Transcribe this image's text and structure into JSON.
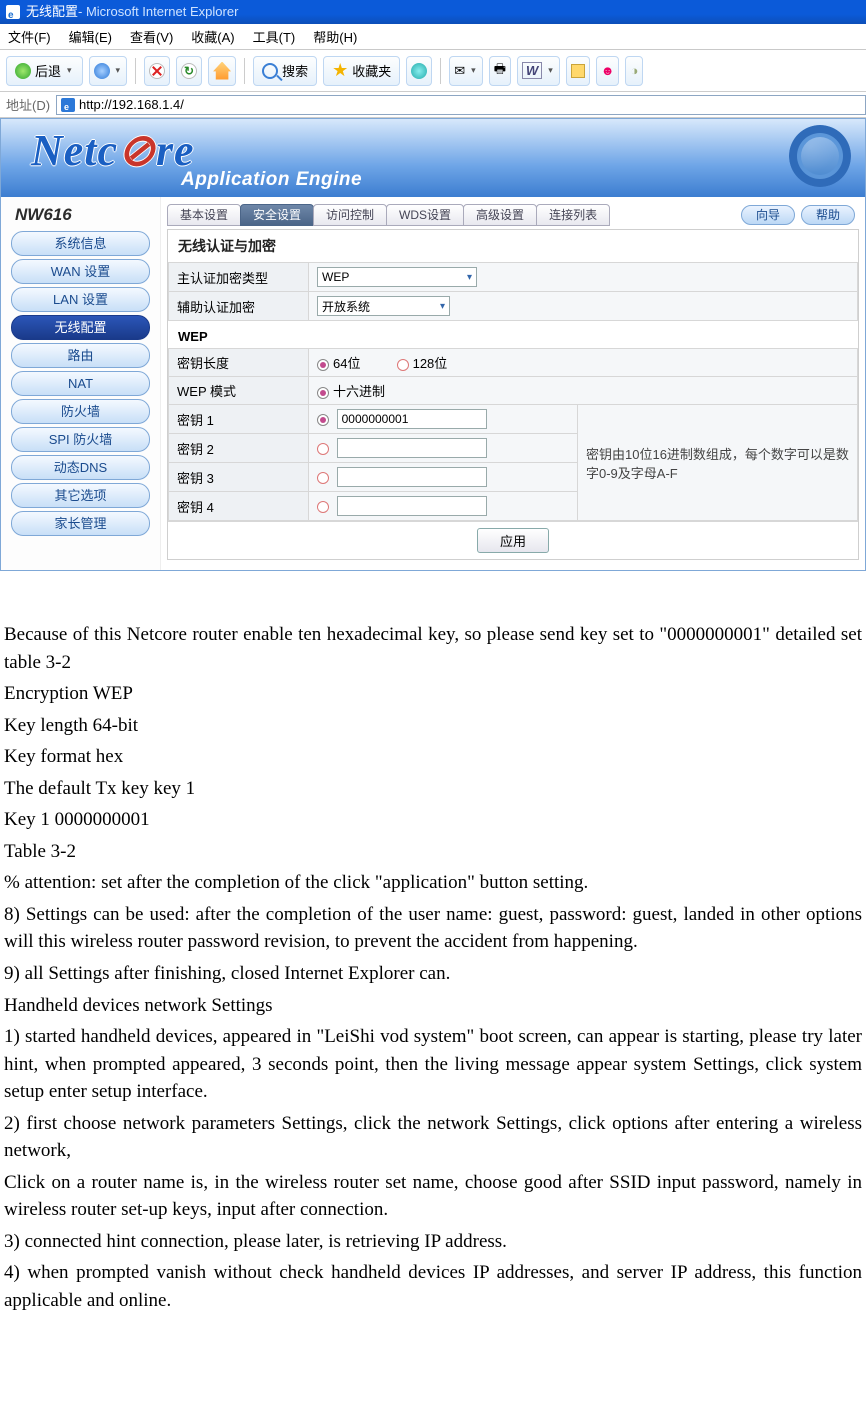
{
  "browser": {
    "title_page": "无线配置",
    "title_app": " - Microsoft Internet Explorer",
    "menu": {
      "file": "文件(F)",
      "edit": "编辑(E)",
      "view": "查看(V)",
      "fav": "收藏(A)",
      "tools": "工具(T)",
      "help": "帮助(H)"
    },
    "toolbar": {
      "back": "后退",
      "search": "搜索",
      "favorites": "收藏夹"
    },
    "address_label": "地址(D)",
    "url": "http://192.168.1.4/"
  },
  "router": {
    "logo_left": "Netc",
    "logo_right": "re",
    "subtitle": "Application Engine",
    "model": "NW616",
    "sidebar": [
      "系统信息",
      "WAN 设置",
      "LAN 设置",
      "无线配置",
      "路由",
      "NAT",
      "防火墙",
      "SPI 防火墙",
      "动态DNS",
      "其它选项",
      "家长管理"
    ],
    "sidebar_active_index": 3,
    "tabs": [
      "基本设置",
      "安全设置",
      "访问控制",
      "WDS设置",
      "高级设置",
      "连接列表"
    ],
    "tabs_sel_index": 1,
    "right_pills": {
      "wizard": "向导",
      "help": "帮助"
    },
    "auth_section": {
      "title": "无线认证与加密",
      "rows": {
        "main_type_label": "主认证加密类型",
        "main_type_value": "WEP",
        "aux_label": "辅助认证加密",
        "aux_value": "开放系统"
      }
    },
    "wep_section": {
      "title": "WEP",
      "keylen_label": "密钥长度",
      "keylen_64": "64位",
      "keylen_128": "128位",
      "mode_label": "WEP 模式",
      "mode_value": "十六进制",
      "key_labels": [
        "密钥 1",
        "密钥 2",
        "密钥 3",
        "密钥 4"
      ],
      "key_values": [
        "0000000001",
        "",
        "",
        ""
      ],
      "key_selected_index": 0,
      "hint": "密钥由10位16进制数组成，每个数字可以是数字0-9及字母A-F",
      "apply": "应用"
    }
  },
  "doc": {
    "p1": "Because of this Netcore router enable ten hexadecimal key, so please send key set to \"0000000001\" detailed set table 3-2",
    "p2": "Encryption WEP",
    "p3": "Key length 64-bit",
    "p4": "Key format hex",
    "p5": "The default Tx key key 1",
    "p6": "Key 1 0000000001",
    "p7": "Table 3-2",
    "p8": "% attention: set after the completion of the click \"application\" button setting.",
    "p9": "8) Settings can be used: after the completion of the user name: guest, password: guest, landed in other options will this wireless router password revision, to prevent the accident from happening.",
    "p10": "9) all Settings after finishing, closed Internet Explorer can.",
    "p11": "Handheld devices network Settings",
    "p12": "1) started handheld devices, appeared in \"LeiShi vod system\" boot screen, can appear is starting, please try later hint, when prompted appeared, 3 seconds point, then the living message appear system Settings, click system setup enter setup interface.",
    "p13": "2) first choose network parameters Settings, click the network Settings, click options after entering a wireless network,",
    "p14": "Click on a router name is, in the wireless router set name, choose good after SSID input password, namely in wireless router set-up keys, input after connection.",
    "p15": "3) connected hint connection, please later, is retrieving IP address.",
    "p16": "4) when prompted vanish without check handheld devices IP addresses, and server IP address, this function applicable and online."
  }
}
